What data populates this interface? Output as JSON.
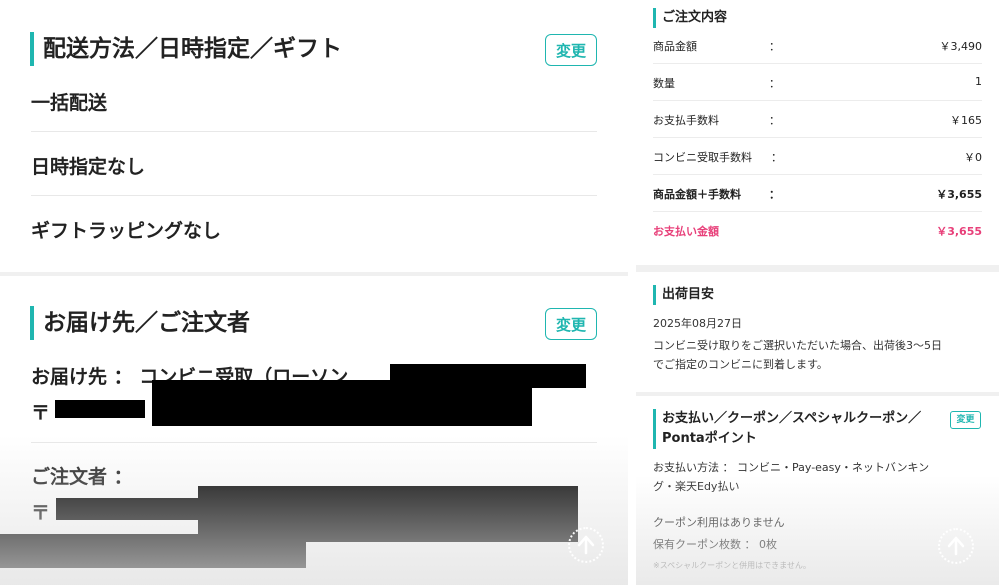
{
  "delivery": {
    "title": "配送方法／日時指定／ギフト",
    "change_label": "変更",
    "method": "一括配送",
    "datetime": "日時指定なし",
    "gift": "ギフトラッピングなし"
  },
  "recipient": {
    "title": "お届け先／ご注文者",
    "change_label": "変更",
    "deliver_to_label": "お届け先 ： コンビニ受取（ローソン",
    "postal_mark": "〒",
    "orderer_label": "ご注文者 ：",
    "orderer_postal_mark": "〒"
  },
  "order": {
    "title": "ご注文内容",
    "rows": [
      {
        "label": "商品金額",
        "colon": "：",
        "value": "￥3,490"
      },
      {
        "label": "数量",
        "colon": "：",
        "value": "1"
      },
      {
        "label": "お支払手数料",
        "colon": "：",
        "value": "￥165"
      },
      {
        "label": "コンビニ受取手数料",
        "colon": "：",
        "value": "￥0"
      },
      {
        "label": "商品金額＋手数料",
        "colon": "：",
        "value": "￥3,655"
      },
      {
        "label": "お支払い金額",
        "colon": "",
        "value": "￥3,655"
      }
    ]
  },
  "shipping": {
    "title": "出荷目安",
    "date": "2025年08月27日",
    "note_line1": "コンビニ受け取りをご選択いただいた場合、出荷後3〜5日",
    "note_line2": "でご指定のコンビニに到着します。"
  },
  "payment": {
    "title_line1": "お支払い／クーポン／スペシャルクーポン／",
    "title_line2": "Pontaポイント",
    "change_label": "変更",
    "method_line1": "お支払い方法 ： コンビニ・Pay-easy・ネットバンキン",
    "method_line2": "グ・楽天Edy払い",
    "coupon_status": "クーポン利用はありません",
    "coupon_count": "保有クーポン枚数 ： 0枚",
    "note": "※スペシャルクーポンと併用はできません。"
  },
  "colors": {
    "accent": "#1fb6b0",
    "total": "#e8407a"
  },
  "icons": {
    "scroll_top": "arrow-up-icon"
  }
}
